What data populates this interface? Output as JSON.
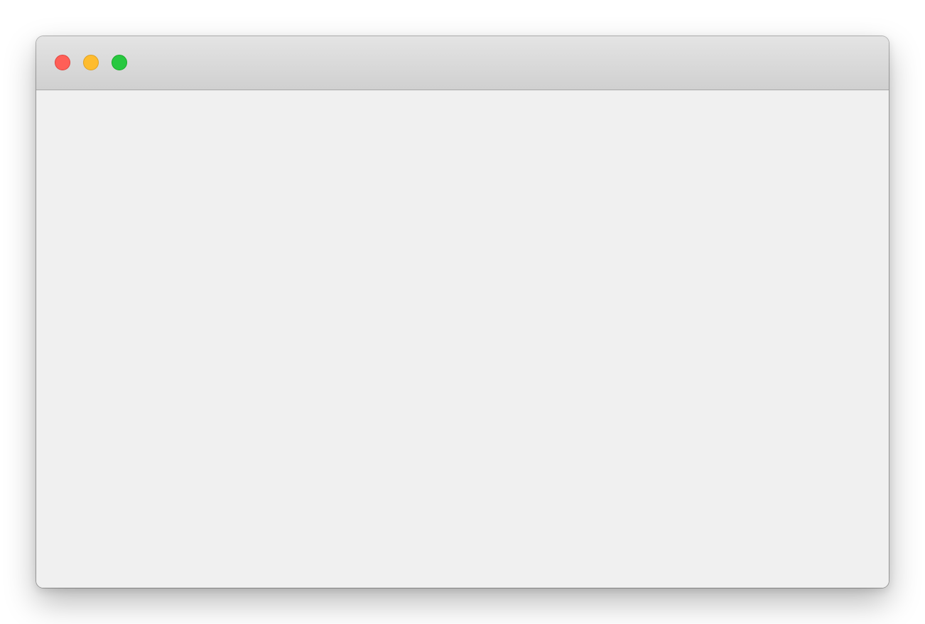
{
  "window": {
    "title": "",
    "controls": [
      {
        "name": "close",
        "icon": "close-dot-icon",
        "color": "#ff5f57",
        "border": "#e0443e"
      },
      {
        "name": "minimize",
        "icon": "minimize-dot-icon",
        "color": "#febc2e",
        "border": "#dea123"
      },
      {
        "name": "maximize",
        "icon": "maximize-dot-icon",
        "color": "#28c840",
        "border": "#1aab29"
      }
    ],
    "colors": {
      "titlebar_top": "#e4e4e4",
      "titlebar_bottom": "#d0d0d0",
      "content_background": "#f0f0f0"
    }
  }
}
